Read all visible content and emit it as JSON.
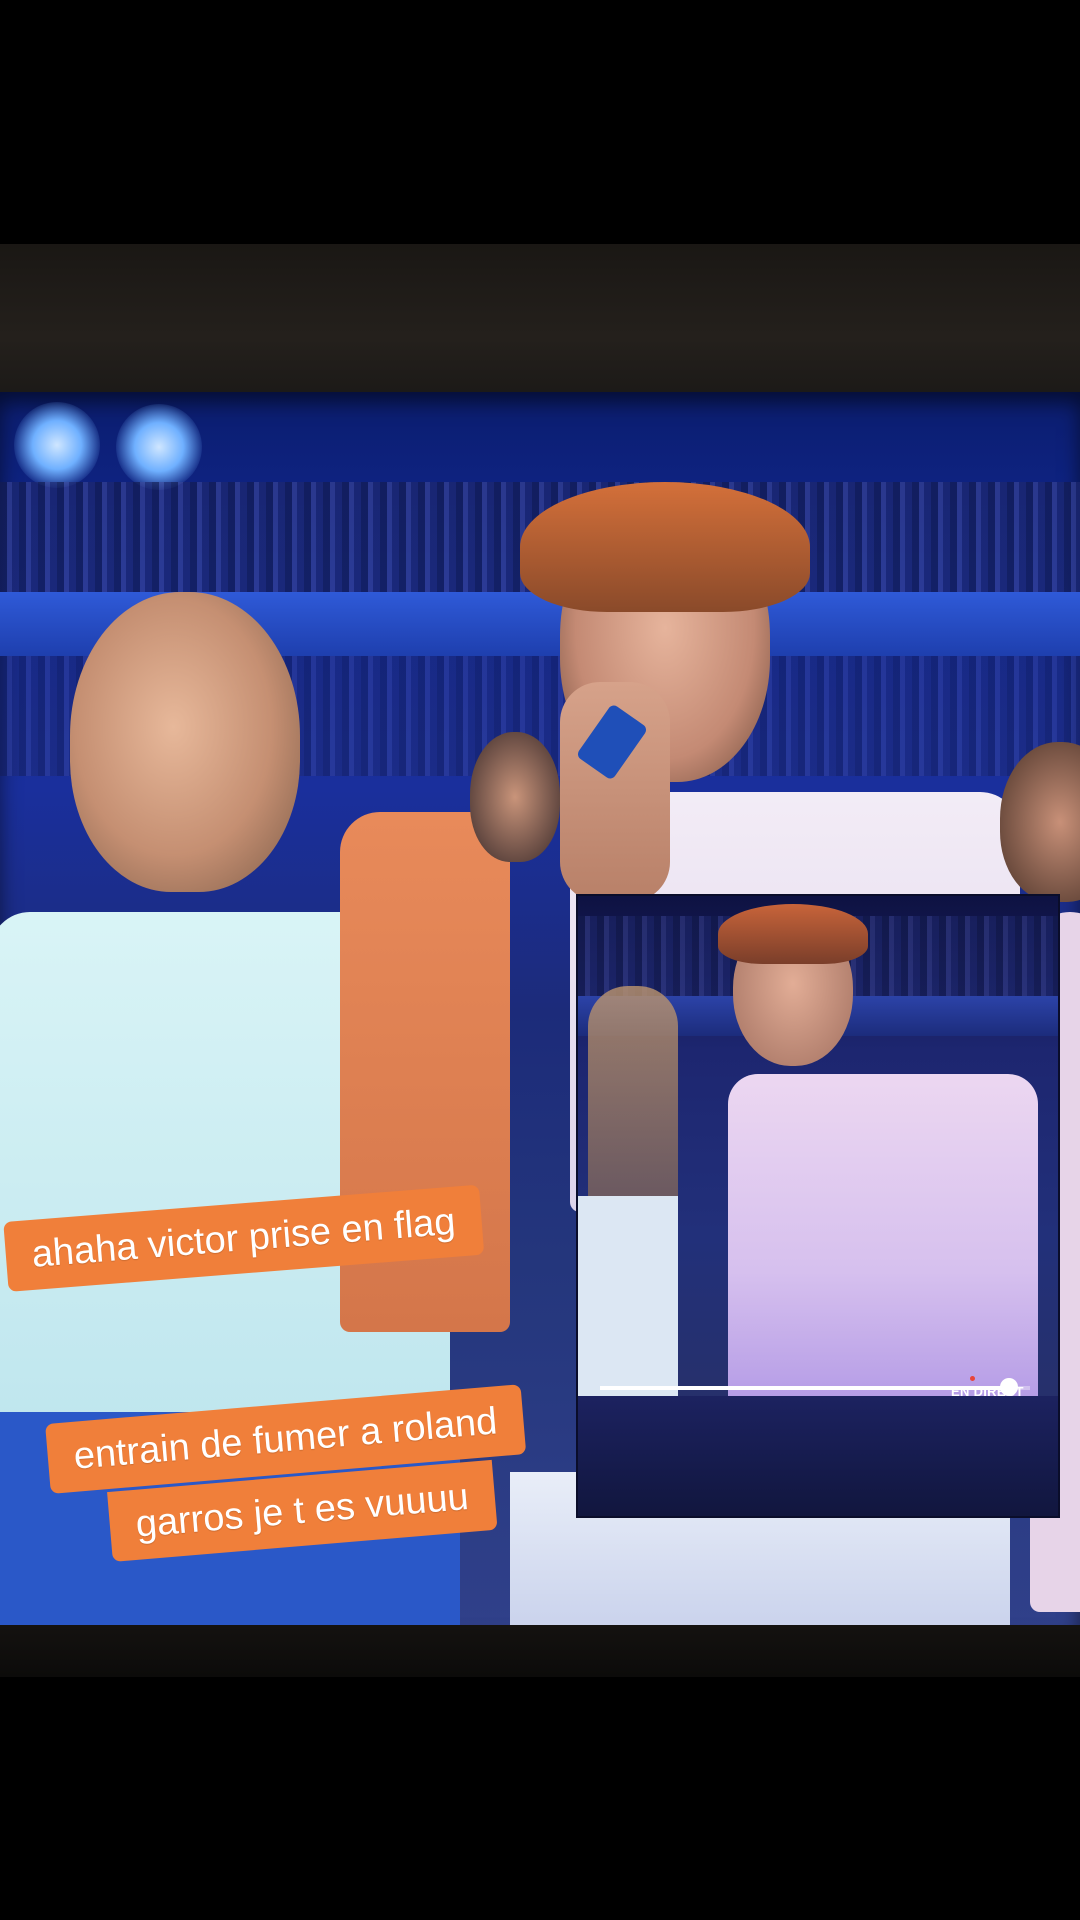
{
  "captions": {
    "line_1": "ahaha victor prise en flag",
    "line_2a": "entrain de fumer a roland",
    "line_2b": "garros je t es vuuuu"
  },
  "inset_video": {
    "live_label": "EN DIRECT",
    "progress": 0.95
  },
  "colors": {
    "caption_background": "#f07f3a",
    "caption_text": "#ffffff",
    "screen_blue": "#1a2f9c"
  }
}
